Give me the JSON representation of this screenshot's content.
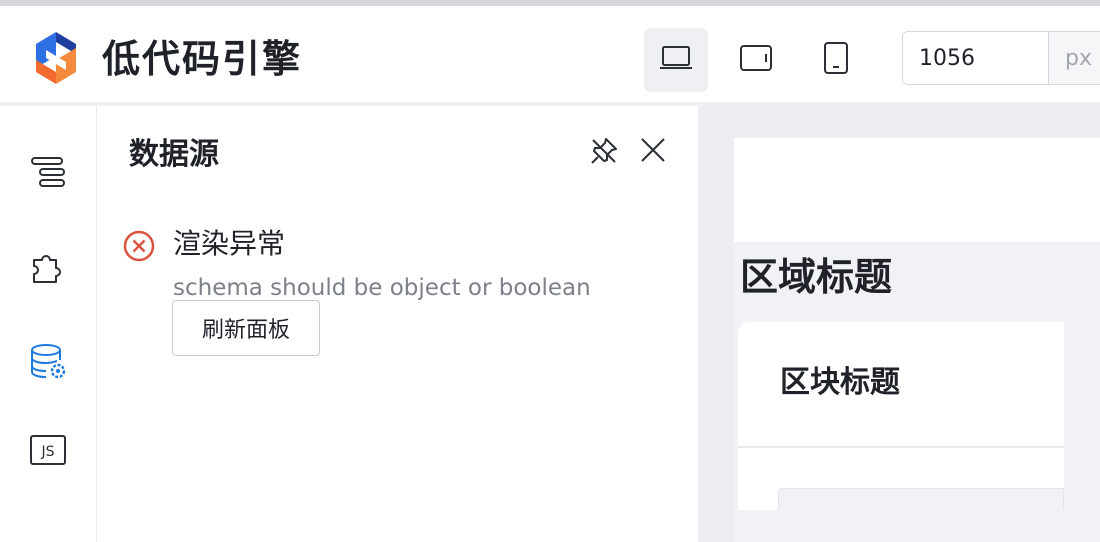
{
  "app": {
    "brand": "低代码引擎",
    "logo_icon": "lowcode-engine-logo-icon"
  },
  "toolbar": {
    "devices": [
      {
        "name": "desktop",
        "icon": "laptop-icon",
        "active": true
      },
      {
        "name": "tablet",
        "icon": "tablet-icon",
        "active": false
      },
      {
        "name": "phone",
        "icon": "phone-icon",
        "active": false
      }
    ],
    "width_value": "1056",
    "width_unit": "px"
  },
  "left_sidebar": {
    "items": [
      {
        "name": "outline",
        "icon": "outline-tree-icon",
        "active": false
      },
      {
        "name": "components",
        "icon": "puzzle-icon",
        "active": false
      },
      {
        "name": "datasource",
        "icon": "database-gear-icon",
        "active": true
      },
      {
        "name": "code",
        "icon": "js-icon",
        "active": false
      }
    ]
  },
  "panel": {
    "title": "数据源",
    "pin_icon": "pin-icon",
    "close_icon": "close-icon",
    "error": {
      "icon": "error-circle-icon",
      "title": "渲染异常",
      "message": "schema should be object or boolean",
      "refresh_label": "刷新面板"
    }
  },
  "canvas": {
    "section_title": "区域标题",
    "card_title": "区块标题"
  },
  "colors": {
    "accent": "#1f7ae0",
    "error": "#d9533f",
    "logo_blue": "#2f6fe4",
    "logo_orange": "#f26a2e"
  }
}
